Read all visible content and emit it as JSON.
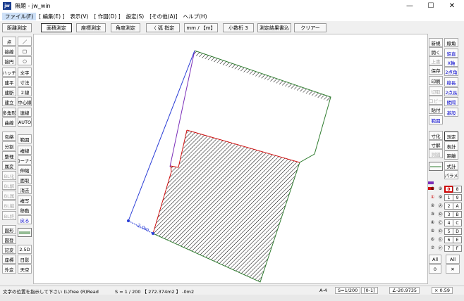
{
  "window": {
    "app_icon_text": "jw",
    "title": "無題 - jw_win",
    "min_glyph": "—",
    "max_glyph": "☐",
    "close_glyph": "✕"
  },
  "menu": [
    "ファイル(F)",
    "[ 編集(E) ]",
    "表示(V)",
    "[ 作図(D) ]",
    "設定(S)",
    "[その他(A)]",
    "ヘルプ(H)"
  ],
  "command_bar": [
    "距離測定",
    "面積測定",
    "座標測定",
    "角度測定",
    "〈 弧 指定",
    "mm / 【m】",
    "小数桁 3",
    "測定結果書込",
    "クリアー"
  ],
  "left_tools": {
    "col1": [
      "点",
      "接線",
      "接円",
      "ハッチ",
      "建平",
      "建断",
      "建立",
      "多角形",
      "曲線",
      "包絡",
      "分割",
      "整理",
      "属変",
      "BL化",
      "BL解",
      "BL属",
      "BL編",
      "BL終",
      "図形",
      "図登",
      "記変",
      "座標",
      "外変"
    ],
    "col2": [
      "／",
      "□",
      "○",
      "文字",
      "寸法",
      "２線",
      "中心線",
      "連線",
      "AUTO",
      "範囲",
      "複線",
      "コーナー",
      "伸縮",
      "面取",
      "消去",
      "複写",
      "移動",
      "戻る",
      "",
      "2.5D",
      "日影",
      "天空"
    ]
  },
  "right_tools": {
    "col1": [
      "新規",
      "開く",
      "上書",
      "保存",
      "印刷",
      "切取",
      "コピー",
      "貼付",
      "範囲",
      "寸化",
      "寸解",
      "測図"
    ],
    "col2": [
      "線角",
      "鉛直",
      "X軸",
      "2点角",
      "線長",
      "2点長",
      "間隔",
      "基設",
      "測定",
      "表計",
      "距離",
      "式計",
      "パラメ"
    ],
    "layers_left": [
      "⑧",
      "①",
      "②",
      "③",
      "④",
      "⑤",
      "⑥",
      "⑦"
    ],
    "layers_left_alt": [
      "⑨",
      "⑨",
      "Ⓐ",
      "Ⓑ",
      "Ⓒ",
      "Ⓓ",
      "Ⓔ",
      "Ⓕ"
    ],
    "layers_right_a": [
      "0",
      "1",
      "2",
      "3",
      "4",
      "5",
      "6",
      "7"
    ],
    "layers_right_b": [
      "8",
      "9",
      "A",
      "B",
      "C",
      "D",
      "E",
      "F"
    ],
    "all_left": "All",
    "all_right": "All",
    "zero_left": "0",
    "cross_right": "✕"
  },
  "drawing": {
    "dimension_label": "2.0m",
    "colors": {
      "outline_green": "#2f7d2f",
      "outline_purple": "#7a2db8",
      "outline_red": "#d01010",
      "measure_blue": "#2a3dd6"
    }
  },
  "status": {
    "message": "文字の位置を指示して下さい (L)free (R)Read",
    "scale_area": "S = 1 / 200 【 272.374m2 】 -0m2",
    "paper": "A-4",
    "scale": "S=1/200",
    "layer": "[0-1]",
    "angle": "∠-20.9735",
    "zoom": "× 0.59"
  }
}
